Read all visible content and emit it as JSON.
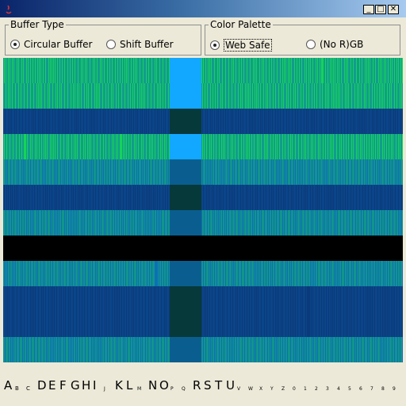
{
  "window": {
    "title": ""
  },
  "buffer_type": {
    "title": "Buffer Type",
    "options": [
      {
        "label": "Circular Buffer",
        "selected": true
      },
      {
        "label": "Shift Buffer",
        "selected": false
      }
    ]
  },
  "color_palette": {
    "title": "Color Palette",
    "options": [
      {
        "label": "Web Safe",
        "selected": true
      },
      {
        "label": "(No R)GB",
        "selected": false
      }
    ]
  },
  "colors": {
    "green": "#17d35a",
    "blue": "#0c6fb7",
    "navy": "#0b3a7a",
    "black": "#000000",
    "cyan": "#12a8ff",
    "dark_teal": "#06393a"
  },
  "bands": [
    {
      "name": "band-green-1",
      "color": "green",
      "height": 32
    },
    {
      "name": "band-green-2",
      "color": "green",
      "height": 32
    },
    {
      "name": "band-navy-1",
      "color": "navy",
      "height": 32
    },
    {
      "name": "band-green-3",
      "color": "green",
      "height": 32
    },
    {
      "name": "band-blue-1",
      "color": "blue",
      "height": 32
    },
    {
      "name": "band-navy-2",
      "color": "navy",
      "height": 32
    },
    {
      "name": "band-blue-2",
      "color": "blue",
      "height": 32
    },
    {
      "name": "band-black",
      "color": "black",
      "height": 32
    },
    {
      "name": "band-blue-3",
      "color": "blue",
      "height": 32
    },
    {
      "name": "band-navy-3",
      "color": "navy",
      "height": 64
    },
    {
      "name": "band-blue-4",
      "color": "blue",
      "height": 32
    }
  ],
  "alphabet": {
    "letters": [
      "A",
      "B",
      "C",
      "D",
      "E",
      "F",
      "G",
      "H",
      "I",
      "J",
      "K",
      "L",
      "M",
      "N",
      "O",
      "P",
      "Q",
      "R",
      "S",
      "T",
      "U",
      "V",
      "W",
      "X",
      "Y",
      "Z",
      "0",
      "1",
      "2",
      "3",
      "4",
      "5",
      "6",
      "7",
      "8",
      "9"
    ],
    "sizes": [
      15,
      7,
      7,
      15,
      15,
      15,
      15,
      15,
      15,
      6,
      15,
      15,
      6,
      15,
      15,
      6,
      6,
      15,
      15,
      15,
      15,
      6,
      6,
      6,
      6,
      6,
      6,
      6,
      6,
      6,
      6,
      6,
      6,
      6,
      6,
      6
    ]
  }
}
